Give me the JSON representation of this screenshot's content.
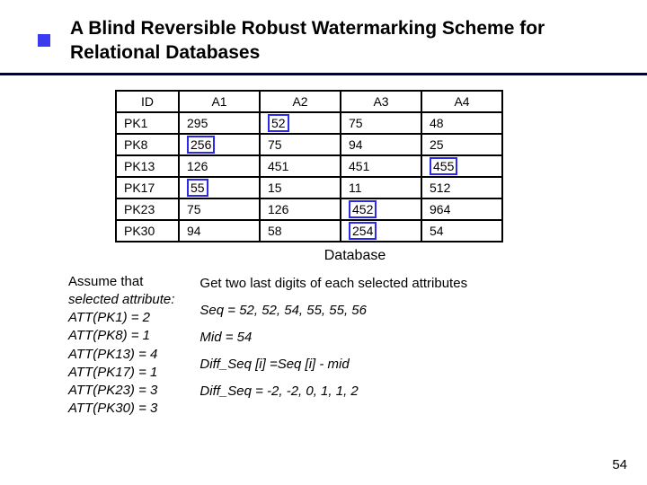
{
  "title": "A Blind Reversible Robust Watermarking Scheme for Relational Databases",
  "table": {
    "headers": [
      "ID",
      "A1",
      "A2",
      "A3",
      "A4"
    ],
    "rows": [
      {
        "id": "PK1",
        "a1": "295",
        "a2": "52",
        "a3": "75",
        "a4": "48",
        "hl": "a2"
      },
      {
        "id": "PK8",
        "a1": "256",
        "a2": "75",
        "a3": "94",
        "a4": "25",
        "hl": "a1"
      },
      {
        "id": "PK13",
        "a1": "126",
        "a2": "451",
        "a3": "451",
        "a4": "455",
        "hl": "a4"
      },
      {
        "id": "PK17",
        "a1": "55",
        "a2": "15",
        "a3": "11",
        "a4": "512",
        "hl": "a1"
      },
      {
        "id": "PK23",
        "a1": "75",
        "a2": "126",
        "a3": "452",
        "a4": "964",
        "hl": "a3"
      },
      {
        "id": "PK30",
        "a1": "94",
        "a2": "58",
        "a3": "254",
        "a4": "54",
        "hl": "a3"
      }
    ]
  },
  "caption": "Database",
  "left": {
    "assume": "Assume that",
    "sel": "selected attribute:",
    "l1": "ATT(PK1) = 2",
    "l2": "ATT(PK8) = 1",
    "l3": "ATT(PK13) = 4",
    "l4": "ATT(PK17) = 1",
    "l5": "ATT(PK23) = 3",
    "l6": "ATT(PK30) = 3"
  },
  "right": {
    "r1": "Get two last digits of each selected attributes",
    "r2": "Seq = 52, 52, 54, 55, 55, 56",
    "r3": "Mid = 54",
    "r4": "Diff_Seq [i] =Seq [i] - mid",
    "r5": "Diff_Seq = -2, -2, 0, 1, 1, 2"
  },
  "pagenum": "54"
}
